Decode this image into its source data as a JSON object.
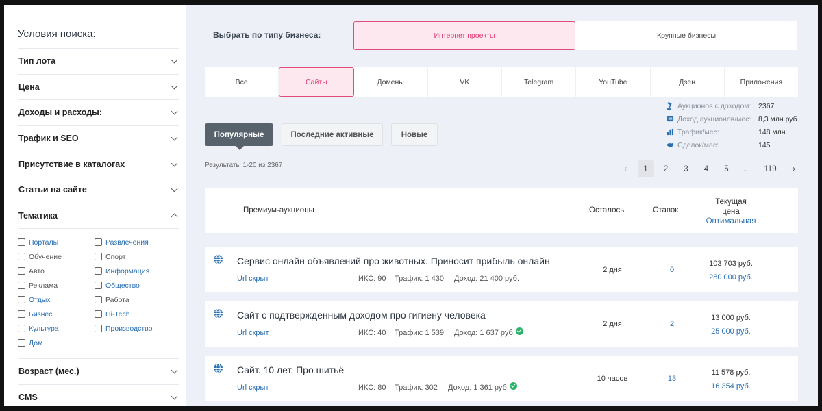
{
  "sidebar": {
    "title": "Условия поиска:",
    "sections_top": [
      "Тип лота",
      "Цена",
      "Доходы и расходы:",
      "Трафик и SEO",
      "Присутствие в каталогах",
      "Статьи на сайте",
      "Тематика"
    ],
    "topics": [
      {
        "label": "Порталы",
        "link": true
      },
      {
        "label": "Развлечения",
        "link": true
      },
      {
        "label": "Обучение",
        "link": false
      },
      {
        "label": "Спорт",
        "link": false
      },
      {
        "label": "Авто",
        "link": false
      },
      {
        "label": "Информация",
        "link": true
      },
      {
        "label": "Реклама",
        "link": false
      },
      {
        "label": "Общество",
        "link": true
      },
      {
        "label": "Отдых",
        "link": true
      },
      {
        "label": "Работа",
        "link": false
      },
      {
        "label": "Бизнес",
        "link": true
      },
      {
        "label": "Hi-Tech",
        "link": true
      },
      {
        "label": "Культура",
        "link": true
      },
      {
        "label": "Производство",
        "link": true
      },
      {
        "label": "Дом",
        "link": true
      }
    ],
    "sections_bottom": [
      "Возраст (мес.)",
      "CMS"
    ]
  },
  "business": {
    "label": "Выбрать по типу бизнеса:",
    "options": [
      "Интернет проекты",
      "Крупные бизнесы"
    ],
    "active": 0
  },
  "categories": {
    "items": [
      "Все",
      "Сайты",
      "Домены",
      "VK",
      "Telegram",
      "YouTube",
      "Дзен",
      "Приложения"
    ],
    "active": 1
  },
  "stats": [
    {
      "icon": "hammer-icon",
      "label": "Аукционов с доходом:",
      "value": "2367"
    },
    {
      "icon": "wallet-icon",
      "label": "Доход аукционов/мес:",
      "value": "8,3 млн.руб."
    },
    {
      "icon": "bar-chart-icon",
      "label": "Трафик/мес:",
      "value": "148 млн."
    },
    {
      "icon": "handshake-icon",
      "label": "Сделок/мес:",
      "value": "145"
    }
  ],
  "sort": {
    "items": [
      "Популярные",
      "Последние активные",
      "Новые"
    ],
    "active": 0
  },
  "results_text": "Результаты 1-20 из 2367",
  "pagination": {
    "prev": "‹",
    "pages": [
      "1",
      "2",
      "3",
      "4",
      "5",
      "…",
      "119"
    ],
    "next": "›",
    "active": "1"
  },
  "table_header": {
    "premium": "Премиум-аукционы",
    "left": "Осталось",
    "bids": "Ставок",
    "price_line1": "Текущая",
    "price_line2": "цена",
    "price_sort": "Оптимальная"
  },
  "rows": [
    {
      "title": "Сервис онлайн объявлений про животных. Приносит прибыль онлайн",
      "url": "Url скрыт",
      "iks": "ИКС: 90",
      "traffic": "Трафик: 1 430",
      "income": "Доход: 21 400 руб.",
      "verified": false,
      "left": "2 дня",
      "bids": "0",
      "price": "103 703 руб.",
      "optimal": "280 000 руб."
    },
    {
      "title": "Сайт с подтвержденным доходом про гигиену человека",
      "url": "Url скрыт",
      "iks": "ИКС: 40",
      "traffic": "Трафик: 1 539",
      "income": "Доход: 1 637 руб.",
      "verified": true,
      "left": "2 дня",
      "bids": "2",
      "price": "13 000 руб.",
      "optimal": "25 000 руб."
    },
    {
      "title": "Сайт. 10 лет. Про шитьё",
      "url": "Url скрыт",
      "iks": "ИКС: 80",
      "traffic": "Трафик: 302",
      "income": "Доход: 1 361 руб.",
      "verified": true,
      "left": "10 часов",
      "bids": "13",
      "price": "11 578 руб.",
      "optimal": "16 354 руб."
    }
  ],
  "colors": {
    "accent": "#e0386e",
    "accent_bg": "#fde8ef",
    "link": "#2a6fb0",
    "dark_button": "#58626c",
    "verified": "#2db36a",
    "page_bg": "#eef0f8"
  }
}
